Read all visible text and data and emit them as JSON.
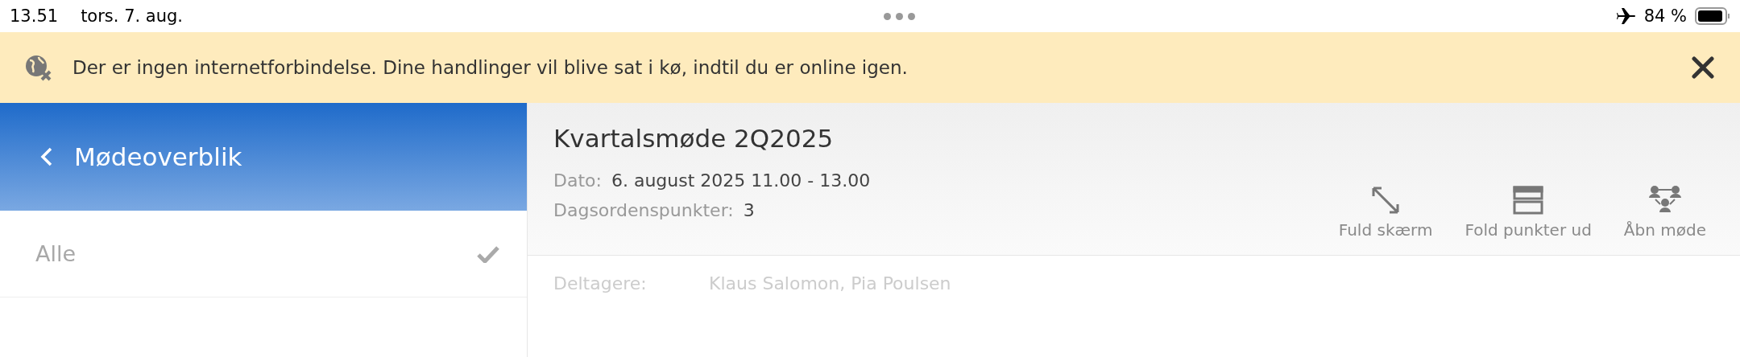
{
  "status_bar": {
    "time": "13.51",
    "date": "tors. 7. aug.",
    "airplane_mode": true,
    "battery": "84 %"
  },
  "banner": {
    "message": "Der er ingen internetforbindelse. Dine handlinger vil blive sat i kø, indtil du er online igen."
  },
  "sidebar": {
    "title": "Mødeoverblik",
    "items": [
      {
        "label": "Alle",
        "selected": true
      }
    ]
  },
  "meeting": {
    "title": "Kvartalsmøde 2Q2025",
    "fields": [
      {
        "label": "Dato:",
        "value": "6. august 2025 11.00 - 13.00"
      },
      {
        "label": "Dagsordenspunkter:",
        "value": "3"
      }
    ],
    "actions": [
      {
        "kind": "fullscreen",
        "label": "Fuld skærm"
      },
      {
        "kind": "expand",
        "label": "Fold punkter ud"
      },
      {
        "kind": "open",
        "label": "Åbn møde"
      }
    ],
    "participants": {
      "label": "Deltagere:",
      "value": "Klaus Salomon, Pia Poulsen"
    }
  }
}
